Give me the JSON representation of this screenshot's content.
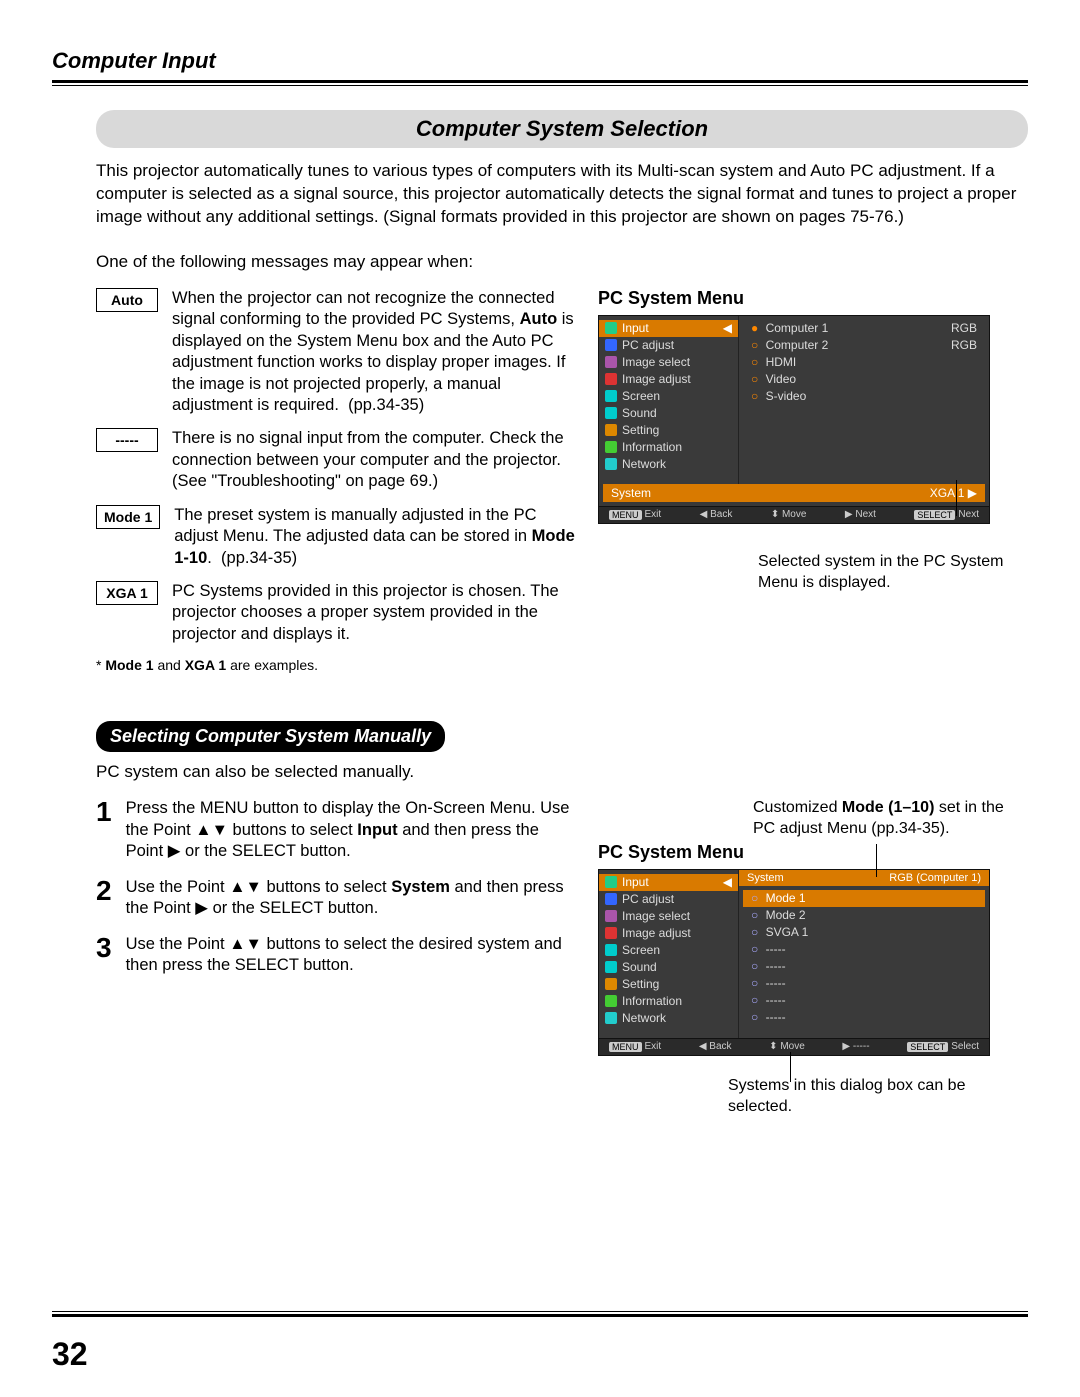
{
  "header": {
    "title": "Computer Input"
  },
  "sectionTitle": "Computer System Selection",
  "intro": "This projector automatically tunes to various types of computers with its Multi-scan system and Auto PC adjustment. If a computer is selected as a signal source, this projector automatically detects the signal format and tunes to project a proper image without any additional settings. (Signal formats provided in this projector are shown on pages 75-76.)",
  "oneOf": "One of the following messages may appear when:",
  "messages": [
    {
      "label": "Auto",
      "desc_html": "When the projector can not recognize the connected signal conforming to the provided PC Systems, <b>Auto</b> is displayed on the System Menu box and the Auto PC adjustment function works to display proper images. If the image is not projected properly, a manual adjustment is required.&nbsp;&nbsp;(pp.34-35)"
    },
    {
      "label": "-----",
      "desc_html": "There is no signal input from the computer. Check the connection between your computer and the projector. (See \"Troubleshooting\" on page 69.)"
    },
    {
      "label": "Mode 1",
      "desc_html": "The preset system is manually adjusted in the PC adjust Menu. The adjusted data can be stored in <b>Mode 1-10</b>.&nbsp;&nbsp;(pp.34-35)"
    },
    {
      "label": "XGA 1",
      "desc_html": "PC Systems provided in this projector is chosen. The projector chooses a proper system provided in the projector and displays it."
    }
  ],
  "footnote_html": "* <b>Mode 1</b> and <b>XGA 1</b> are examples.",
  "subsectionTitle": "Selecting Computer System Manually",
  "manualIntro": "PC system can also be selected manually.",
  "steps": [
    {
      "n": "1",
      "desc_html": "Press the MENU button to display the On-Screen Menu. Use the Point ▲▼ buttons to select <b>Input</b> and then press the Point ▶ or the SELECT button."
    },
    {
      "n": "2",
      "desc_html": "Use the Point ▲▼ buttons to select <b>System</b> and then press the Point ▶ or the SELECT button."
    },
    {
      "n": "3",
      "desc_html": "Use the Point ▲▼ buttons to select the desired system and then press the SELECT button."
    }
  ],
  "menuTitle1": "PC System Menu",
  "menu1": {
    "left": [
      "Input",
      "PC adjust",
      "Image select",
      "Image adjust",
      "Screen",
      "Sound",
      "Setting",
      "Information",
      "Network"
    ],
    "right": [
      {
        "label": "Computer 1",
        "tag": "RGB",
        "bullet": "●"
      },
      {
        "label": "Computer 2",
        "tag": "RGB",
        "bullet": "○"
      },
      {
        "label": "HDMI",
        "tag": "",
        "bullet": "○"
      },
      {
        "label": "Video",
        "tag": "",
        "bullet": "○"
      },
      {
        "label": "S-video",
        "tag": "",
        "bullet": "○"
      }
    ],
    "systemLabel": "System",
    "systemValue": "XGA 1 ▶",
    "footer": {
      "menu": "MENU",
      "exit": "Exit",
      "back": "◀ Back",
      "move": "⬍ Move",
      "next": "▶ Next",
      "select": "SELECT",
      "selAction": "Next"
    }
  },
  "caption1": "Selected system in the PC System Menu is displayed.",
  "menuTitle2": "PC System Menu",
  "caption2top_html": "Customized <b>Mode (1–10)</b> set in the PC adjust Menu (pp.34-35).",
  "menu2": {
    "left": [
      "Input",
      "PC adjust",
      "Image select",
      "Image adjust",
      "Screen",
      "Sound",
      "Setting",
      "Information",
      "Network"
    ],
    "sysHeader1": "System",
    "sysHeader2": "RGB (Computer 1)",
    "right": [
      {
        "label": "Mode 1",
        "sel": true
      },
      {
        "label": "Mode 2"
      },
      {
        "label": "SVGA 1"
      },
      {
        "label": "-----"
      },
      {
        "label": "-----"
      },
      {
        "label": "-----"
      },
      {
        "label": "-----"
      },
      {
        "label": "-----"
      }
    ],
    "footer": {
      "menu": "MENU",
      "exit": "Exit",
      "back": "◀ Back",
      "move": "⬍ Move",
      "next": "▶ -----",
      "select": "SELECT",
      "selAction": "Select"
    }
  },
  "caption2": "Systems in this dialog box can be selected.",
  "pageNumber": "32"
}
